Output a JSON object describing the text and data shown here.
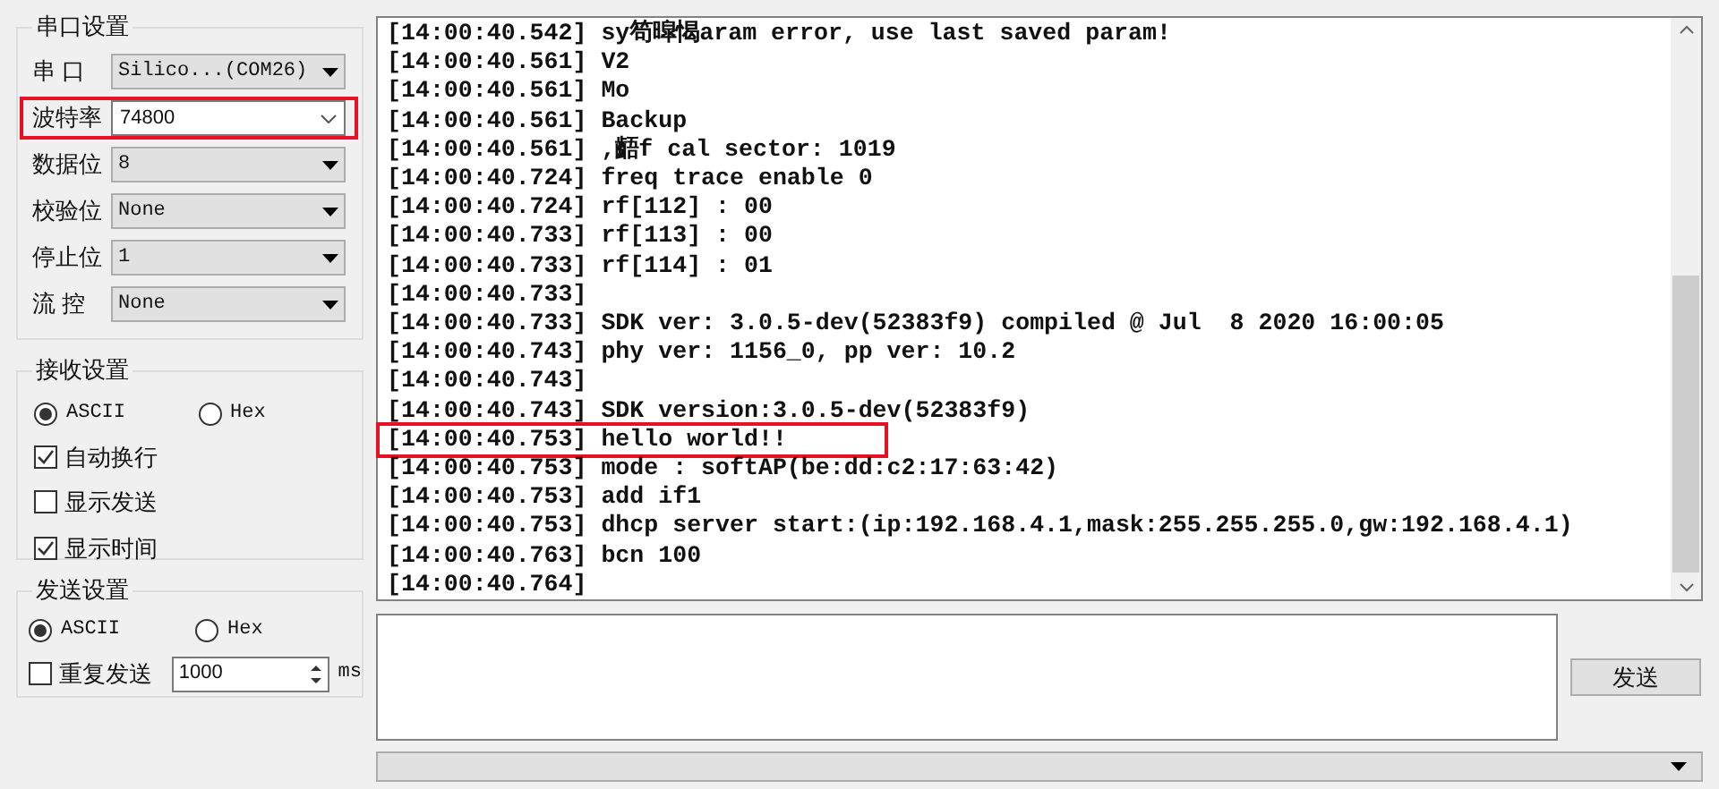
{
  "port_settings": {
    "title": "串口设置",
    "fields": [
      {
        "label": "串 口",
        "value": "Silico...(COM26)",
        "kind": "combo",
        "highlighted": false
      },
      {
        "label": "波特率",
        "value": "74800",
        "kind": "editable",
        "highlighted": true
      },
      {
        "label": "数据位",
        "value": "8",
        "kind": "combo",
        "highlighted": false
      },
      {
        "label": "校验位",
        "value": "None",
        "kind": "combo",
        "highlighted": false
      },
      {
        "label": "停止位",
        "value": "1",
        "kind": "combo",
        "highlighted": false
      },
      {
        "label": "流 控",
        "value": "None",
        "kind": "combo",
        "highlighted": false
      }
    ]
  },
  "receive_settings": {
    "title": "接收设置",
    "modes": [
      {
        "label": "ASCII",
        "selected": true
      },
      {
        "label": "Hex",
        "selected": false
      }
    ],
    "options": [
      {
        "label": "自动换行",
        "checked": true
      },
      {
        "label": "显示发送",
        "checked": false
      },
      {
        "label": "显示时间",
        "checked": true
      }
    ]
  },
  "send_settings": {
    "title": "发送设置",
    "modes": [
      {
        "label": "ASCII",
        "selected": true
      },
      {
        "label": "Hex",
        "selected": false
      }
    ],
    "repeat": {
      "label": "重复发送",
      "checked": false
    },
    "interval": "1000",
    "unit": "ms"
  },
  "log": [
    {
      "text": "[14:00:40.542] sy笱暭愒aram error, use last saved param!",
      "highlighted": false
    },
    {
      "text": "[14:00:40.561] V2",
      "highlighted": false
    },
    {
      "text": "[14:00:40.561] Mo",
      "highlighted": false
    },
    {
      "text": "[14:00:40.561] Backup",
      "highlighted": false
    },
    {
      "text": "[14:00:40.561] ,齬f cal sector: 1019",
      "highlighted": false
    },
    {
      "text": "[14:00:40.724] freq trace enable 0",
      "highlighted": false
    },
    {
      "text": "[14:00:40.724] rf[112] : 00",
      "highlighted": false
    },
    {
      "text": "[14:00:40.733] rf[113] : 00",
      "highlighted": false
    },
    {
      "text": "[14:00:40.733] rf[114] : 01",
      "highlighted": false
    },
    {
      "text": "[14:00:40.733]",
      "highlighted": false
    },
    {
      "text": "[14:00:40.733] SDK ver: 3.0.5-dev(52383f9) compiled @ Jul  8 2020 16:00:05",
      "highlighted": false
    },
    {
      "text": "[14:00:40.743] phy ver: 1156_0, pp ver: 10.2",
      "highlighted": false
    },
    {
      "text": "[14:00:40.743]",
      "highlighted": false
    },
    {
      "text": "[14:00:40.743] SDK version:3.0.5-dev(52383f9)",
      "highlighted": false
    },
    {
      "text": "[14:00:40.753] hello world!!",
      "highlighted": true
    },
    {
      "text": "[14:00:40.753] mode : softAP(be:dd:c2:17:63:42)",
      "highlighted": false
    },
    {
      "text": "[14:00:40.753] add if1",
      "highlighted": false
    },
    {
      "text": "[14:00:40.753] dhcp server start:(ip:192.168.4.1,mask:255.255.255.0,gw:192.168.4.1)",
      "highlighted": false
    },
    {
      "text": "[14:00:40.763] bcn 100",
      "highlighted": false
    },
    {
      "text": "[14:00:40.764]",
      "highlighted": false
    }
  ],
  "send_button": "发送"
}
